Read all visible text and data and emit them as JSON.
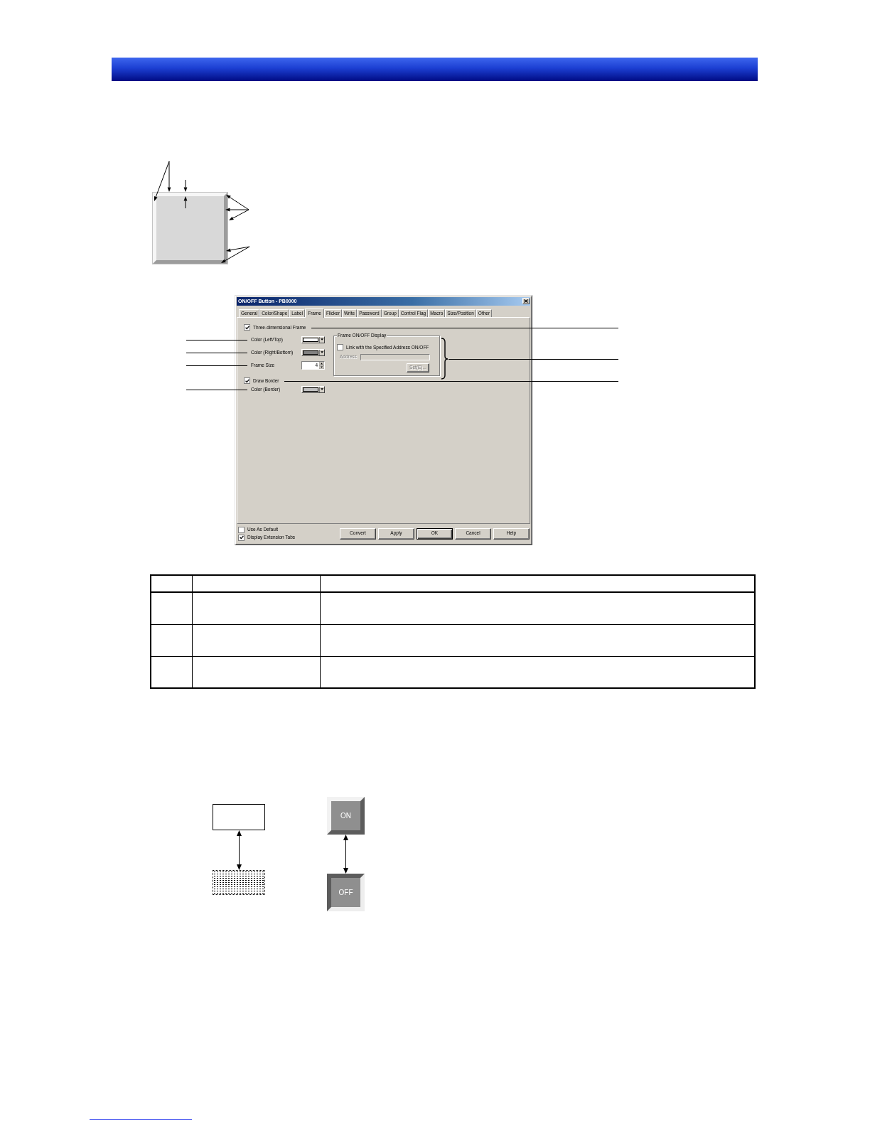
{
  "dialog": {
    "title": "ON/OFF Button - PB0000",
    "tabs": [
      {
        "label": "General",
        "selected": false
      },
      {
        "label": "Color/Shape",
        "selected": false
      },
      {
        "label": "Label",
        "selected": false
      },
      {
        "label": "Frame",
        "selected": true
      },
      {
        "label": "Flicker",
        "selected": false
      },
      {
        "label": "Write",
        "selected": false
      },
      {
        "label": "Password",
        "selected": false
      },
      {
        "label": "Group",
        "selected": false
      },
      {
        "label": "Control Flag",
        "selected": false
      },
      {
        "label": "Macro",
        "selected": false
      },
      {
        "label": "Size/Position",
        "selected": false
      },
      {
        "label": "Other",
        "selected": false
      }
    ],
    "sections": [
      {
        "checkbox": {
          "label": "Three-dimensional Frame",
          "checked": true
        },
        "fields": [
          {
            "kind": "color",
            "label": "Color (Left/Top)",
            "color": "#ffffff"
          },
          {
            "kind": "color",
            "label": "Color (Right/Bottom)",
            "color": "#808080"
          },
          {
            "kind": "spin",
            "label": "Frame Size",
            "value": "4"
          }
        ],
        "group": {
          "title": "Frame ON/OFF Display",
          "checkbox": {
            "label": "Link with the Specified Address ON/OFF",
            "checked": false
          },
          "address": {
            "label": "Address",
            "disabled": true
          },
          "set_button": {
            "label": "Set(E)...",
            "disabled": true
          }
        }
      },
      {
        "checkbox": {
          "label": "Draw Border",
          "checked": true
        },
        "fields": [
          {
            "kind": "color",
            "label": "Color (Border)",
            "color": "#c0c0c0"
          }
        ]
      }
    ],
    "footer_checks": [
      {
        "label": "Use As Default",
        "checked": false
      },
      {
        "label": "Display Extension Tabs",
        "checked": true
      }
    ],
    "buttons": [
      {
        "label": "Convert",
        "default": false
      },
      {
        "label": "Apply",
        "default": false
      },
      {
        "label": "OK",
        "default": true
      },
      {
        "label": "Cancel",
        "default": false
      },
      {
        "label": "Help",
        "default": false
      }
    ]
  },
  "state_figure": {
    "buttons": [
      {
        "label": "ON",
        "pressed": false
      },
      {
        "label": "OFF",
        "pressed": true
      }
    ]
  }
}
